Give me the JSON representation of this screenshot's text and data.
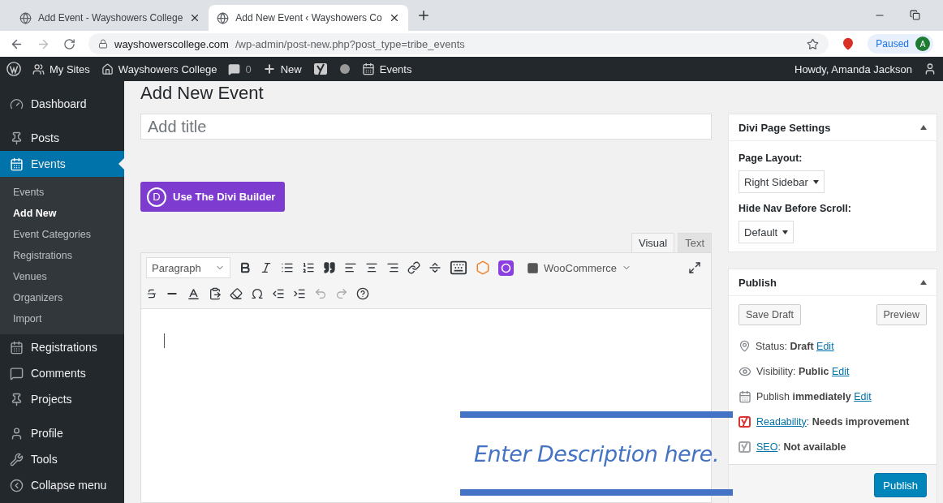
{
  "browser": {
    "tabs": [
      {
        "title": "Add Event - Wayshowers College",
        "selected": false
      },
      {
        "title": "Add New Event ‹ Wayshowers Co",
        "selected": true
      }
    ],
    "url": {
      "domain": "wayshowerscollege.com",
      "path": "/wp-admin/post-new.php?post_type=tribe_events"
    },
    "profile": {
      "label": "Paused",
      "avatar": "A"
    }
  },
  "admin_bar": {
    "items": [
      {
        "kind": "wordpress"
      },
      {
        "kind": "sites",
        "label": "My Sites"
      },
      {
        "kind": "home",
        "label": "Wayshowers College"
      },
      {
        "kind": "comments",
        "label": "0"
      },
      {
        "kind": "new",
        "label": "New"
      },
      {
        "kind": "yoast"
      },
      {
        "kind": "dot"
      },
      {
        "kind": "events",
        "label": "Events"
      }
    ],
    "greeting": "Howdy, Amanda Jackson"
  },
  "sidebar": {
    "items": [
      {
        "kind": "dashboard",
        "label": "Dashboard",
        "selected": false
      },
      {
        "kind": "pin",
        "label": "Posts",
        "selected": false
      },
      {
        "kind": "calendar",
        "label": "Events",
        "selected": true,
        "children": [
          {
            "label": "Events",
            "selected": false
          },
          {
            "label": "Add New",
            "selected": true
          },
          {
            "label": "Event Categories",
            "selected": false
          },
          {
            "label": "Registrations",
            "selected": false
          },
          {
            "label": "Venues",
            "selected": false
          },
          {
            "label": "Organizers",
            "selected": false
          },
          {
            "label": "Import",
            "selected": false
          }
        ]
      },
      {
        "kind": "calendar",
        "label": "Registrations",
        "selected": false
      },
      {
        "kind": "comments",
        "label": "Comments",
        "selected": false
      },
      {
        "kind": "pin",
        "label": "Projects",
        "selected": false
      },
      {
        "kind": "profile",
        "label": "Profile",
        "selected": false
      },
      {
        "kind": "tools",
        "label": "Tools",
        "selected": false
      },
      {
        "kind": "collapse",
        "label": "Collapse menu",
        "selected": false
      }
    ]
  },
  "page_title": "Add New Event",
  "title_field": {
    "placeholder": "Add title"
  },
  "divi_button": {
    "icon": "D",
    "label": "Use The Divi Builder"
  },
  "editor": {
    "tabs": [
      {
        "label": "Visual",
        "selected": true
      },
      {
        "label": "Text",
        "selected": false
      }
    ],
    "format_select": "Paragraph",
    "woocommerce": "WooCommerce"
  },
  "divi_settings": {
    "title": "Divi Page Settings",
    "fields": [
      {
        "label": "Page Layout:",
        "value": "Right Sidebar"
      },
      {
        "label": "Hide Nav Before Scroll:",
        "value": "Default"
      }
    ]
  },
  "publish": {
    "title": "Publish",
    "save_draft": "Save Draft",
    "preview": "Preview",
    "rows": [
      {
        "kind": "status",
        "label": "Status:",
        "value": "Draft",
        "link": "Edit"
      },
      {
        "kind": "visibility",
        "label": "Visibility:",
        "value": "Public",
        "link": "Edit"
      },
      {
        "kind": "schedule",
        "label": "Publish",
        "value": "immediately",
        "link": "Edit"
      },
      {
        "kind": "yoast",
        "link": "Readability",
        "label": ":",
        "value": "Needs improvement",
        "color": "#dc3232"
      },
      {
        "kind": "yoast",
        "link": "SEO",
        "label": ":",
        "value": "Not available",
        "color": "#a0a5aa"
      }
    ],
    "button": "Publish"
  },
  "annotation": {
    "text": "Enter Description here."
  }
}
